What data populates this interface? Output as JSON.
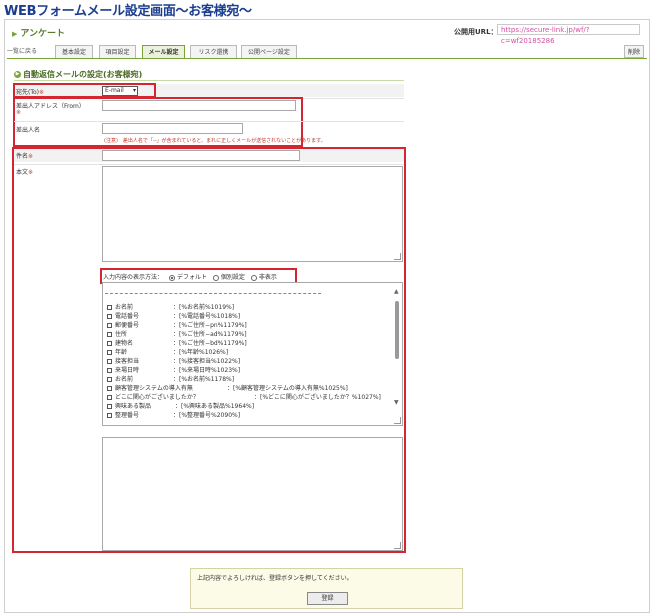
{
  "page_title": "WEBフォームメール設定画面～お客様宛～",
  "app": {
    "title": "アンケート"
  },
  "public_url": {
    "label": "公開用URL：",
    "value": "https://secure-link.jp/wf/?c=wf20185286"
  },
  "nav": {
    "back": "一覧に戻る",
    "tabs": [
      {
        "label": "基本設定"
      },
      {
        "label": "項目設定"
      },
      {
        "label": "メール設定",
        "active": true
      },
      {
        "label": "リスク還携"
      },
      {
        "label": "公開ページ設定"
      }
    ],
    "delete": "削除"
  },
  "section": {
    "title": "自動返信メールの設定(お客様宛)"
  },
  "form": {
    "to": {
      "label": "宛先(To)",
      "req": "※",
      "selected": "E-mail"
    },
    "from_address": {
      "label": "差出人アドレス（From）",
      "req": "※"
    },
    "from_name": {
      "label": "差出人名"
    },
    "from_note": "(注意)　差出人名で「--」が含まれていると、まれに正しくメールが送信されないことがあります。",
    "subject": {
      "label": "件名",
      "req": "※"
    },
    "body": {
      "label": "本文",
      "req": "※"
    },
    "display_method": {
      "label": "入力内容の表示方法：",
      "options": [
        {
          "label": "デフォルト",
          "selected": true
        },
        {
          "label": "個別設定",
          "selected": false
        },
        {
          "label": "非表示",
          "selected": false
        }
      ]
    },
    "fields_list": [
      {
        "name": "お名前",
        "tag": "：[%お名前%1019%]"
      },
      {
        "name": "電話番号",
        "tag": "：[%電話番号%1018%]"
      },
      {
        "name": "郵便番号",
        "tag": "：[%ご住所−pn%1179%]"
      },
      {
        "name": "住所",
        "tag": "：[%ご住所−ad%1179%]"
      },
      {
        "name": "建物名",
        "tag": "：[%ご住所−bd%1179%]"
      },
      {
        "name": "年齢",
        "tag": "：[%年齢%1026%]"
      },
      {
        "name": "接客担当",
        "tag": "：[%接客担当%1022%]"
      },
      {
        "name": "来場日時",
        "tag": "：[%来場日時%1023%]"
      },
      {
        "name": "お名前",
        "tag": "：[%お名前%1178%]"
      },
      {
        "name": "顧客管理システムの導入有無",
        "tag": "：[%顧客管理システムの導入有無%1025%]"
      },
      {
        "name": "どこに関心がございましたか？",
        "tag": "：[%どこに関心がございましたか？%1027%]"
      },
      {
        "name": "興味ある製品",
        "tag": "：[%興味ある製品%1964%]"
      },
      {
        "name": "整理番号",
        "tag": "：[%整理番号%2090%]"
      }
    ]
  },
  "confirm": {
    "text": "上記内容でよろしければ、登録ボタンを押してください。",
    "submit": "登録"
  }
}
